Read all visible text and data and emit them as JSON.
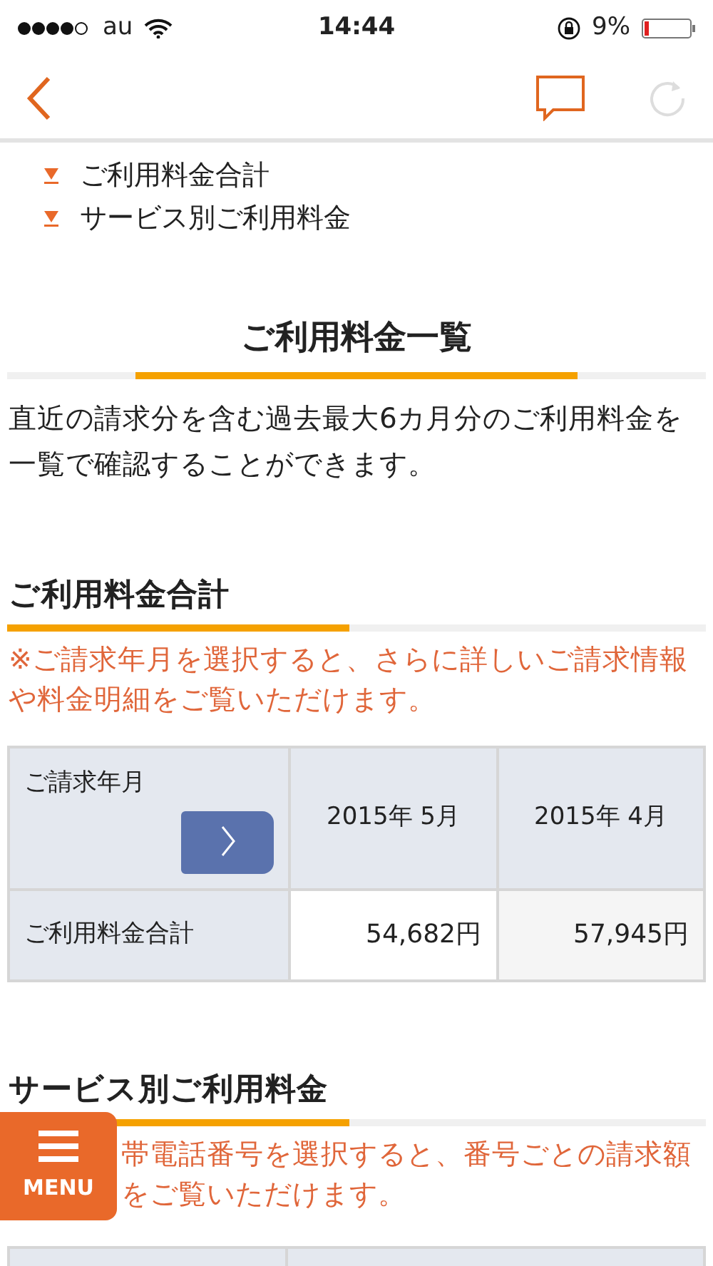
{
  "status_bar": {
    "carrier": "au",
    "time": "14:44",
    "battery": "9%"
  },
  "anchor_links": [
    "ご利用料金合計",
    "サービス別ご利用料金"
  ],
  "page_title": "ご利用料金一覧",
  "description": "直近の請求分を含む過去最大6カ月分のご利用料金を一覧で確認することができます。",
  "summary": {
    "heading": "ご利用料金合計",
    "note": "※ご請求年月を選択すると、さらに詳しいご請求情報や料金明細をご覧いただけます。",
    "table": {
      "corner_label": "ご請求年月",
      "row_label": "ご利用料金合計",
      "months": [
        {
          "label": "2015年 5月",
          "amount": "54,682円"
        },
        {
          "label": "2015年 4月",
          "amount": "57,945円"
        }
      ]
    }
  },
  "services": {
    "heading": "サービス別ご利用料金",
    "note_lines": [
      "帯電話番号を選択すると、番号ごとの請求額",
      "をご覧いただけます。"
    ]
  },
  "menu_button": {
    "label": "MENU"
  }
}
